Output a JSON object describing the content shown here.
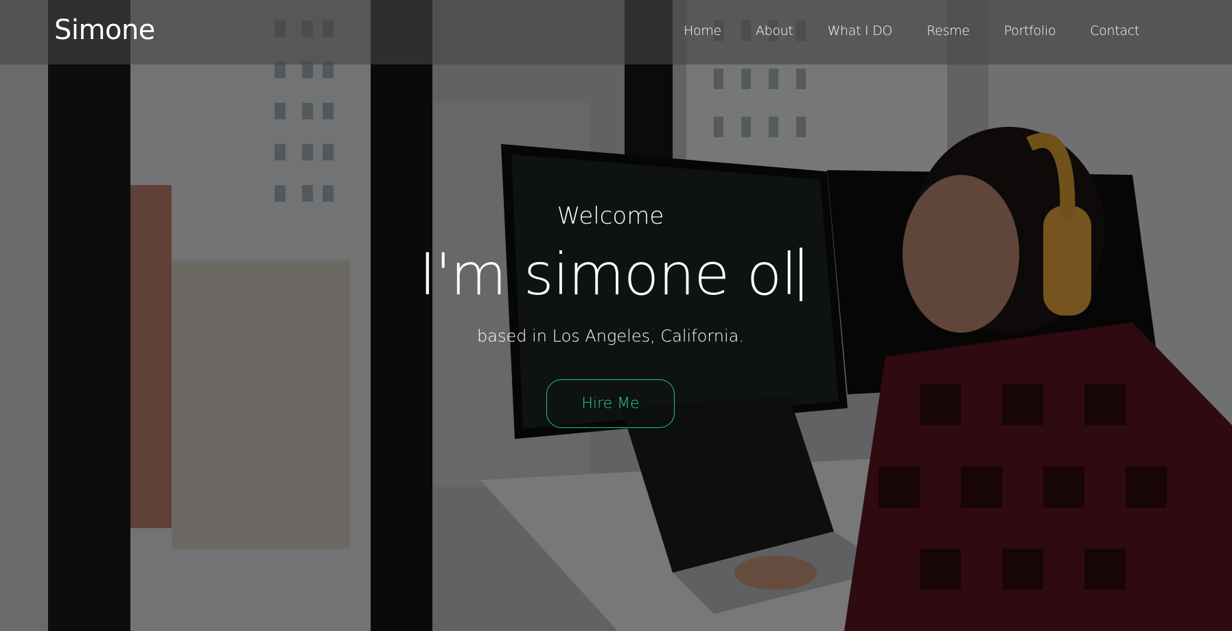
{
  "brand": {
    "logo_text": "Simone"
  },
  "nav": {
    "items": [
      "Home",
      "About",
      "What I DO",
      "Resme",
      "Portfolio",
      "Contact"
    ]
  },
  "hero": {
    "welcome": "Welcome",
    "headline": "I'm simone ol",
    "location": "based in Los Angeles, California.",
    "cta_label": "Hire Me",
    "accent_color": "#20c98a"
  }
}
